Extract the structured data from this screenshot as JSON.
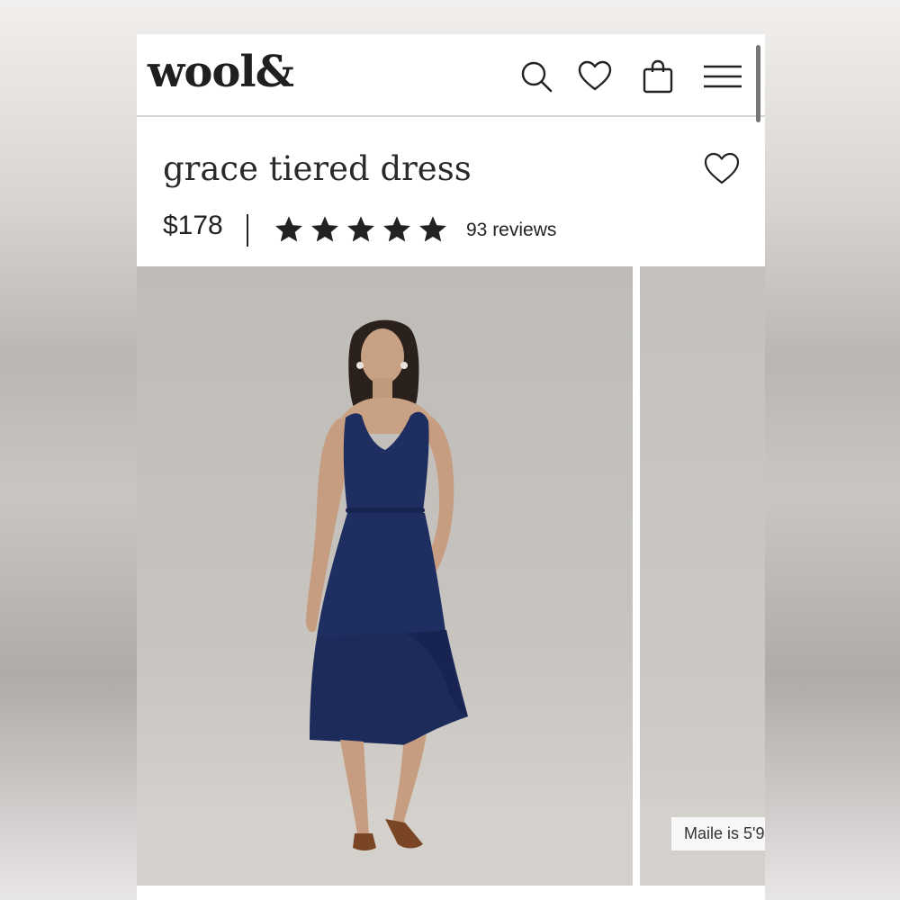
{
  "header": {
    "logo": "wool&",
    "icons": [
      "search-icon",
      "heart-icon",
      "bag-icon",
      "menu-icon"
    ]
  },
  "product": {
    "title": "grace tiered dress",
    "price": "$178",
    "rating": 5,
    "rating_max": 5,
    "reviews": "93 reviews"
  },
  "gallery": {
    "badge": "Maile is 5'9"
  },
  "colors": {
    "text": "#222222",
    "dress": "#1e2d5e",
    "backdrop": "#c4c1bd"
  }
}
